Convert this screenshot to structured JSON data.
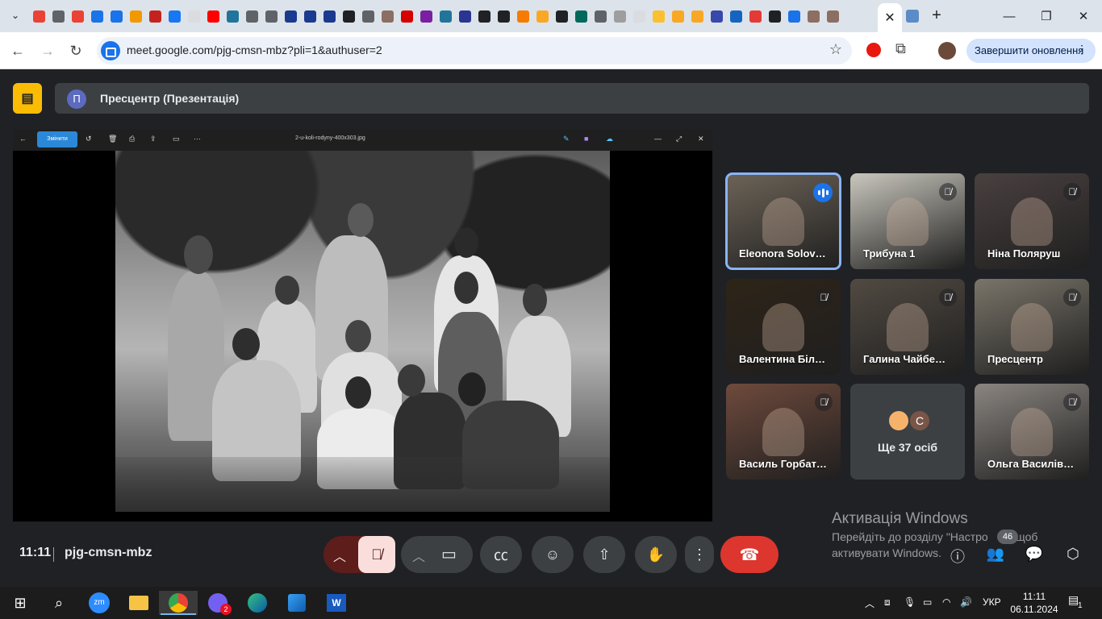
{
  "browser": {
    "url": "meet.google.com/pjg-cmsn-mbz?pli=1&authuser=2",
    "update_button": "Завершити оновлення",
    "active_tab_close": "✕",
    "new_tab": "+",
    "window": {
      "minimize": "—",
      "maximize": "❐",
      "close": "✕"
    },
    "pinned_favicon_colors": [
      "#ea4335",
      "#5f6368",
      "#ea4335",
      "#1a73e8",
      "#1a73e8",
      "#f29900",
      "#c5221f",
      "#1877f2",
      "#dadce0",
      "#ff0000",
      "#21759b",
      "#5f6368",
      "#5f6368",
      "#1a3a8f",
      "#1a3a8f",
      "#1a3a8f",
      "#202124",
      "#5f6368",
      "#8d6e63",
      "#d50000",
      "#7b1fa2",
      "#21759b",
      "#283593",
      "#202124",
      "#202124",
      "#f57c00",
      "#f9a825",
      "#202124",
      "#00695c",
      "#5f6368",
      "#9e9e9e",
      "#dadce0",
      "#fbc02d",
      "#f9a825",
      "#f9a825",
      "#3949ab",
      "#1565c0",
      "#e53935",
      "#202124",
      "#1a73e8",
      "#8d6e63",
      "#8d6e63"
    ]
  },
  "presentation": {
    "avatar_letter": "П",
    "title": "Пресцентр (Презентація)",
    "viewer": {
      "edit_label": "Змінити",
      "file_name": "2-u-koli-rodyny-400x303.jpg"
    }
  },
  "participants": [
    {
      "name": "Eleonora Solov…",
      "muted": false,
      "speaking": true,
      "bg": "#6d6458"
    },
    {
      "name": "Трибуна 1",
      "muted": true,
      "speaking": false,
      "bg": "#c9c7bd"
    },
    {
      "name": "Ніна Поляруш",
      "muted": true,
      "speaking": false,
      "bg": "#4a4040"
    },
    {
      "name": "Валентина Біл…",
      "muted": true,
      "speaking": false,
      "bg": "#2e2418"
    },
    {
      "name": "Галина Чайбе…",
      "muted": true,
      "speaking": false,
      "bg": "#514a42"
    },
    {
      "name": "Пресцентр",
      "muted": true,
      "speaking": false,
      "bg": "#7a756a"
    },
    {
      "name": "Василь Горбат…",
      "muted": true,
      "speaking": false,
      "bg": "#6e4a3c"
    },
    {
      "name": "Ще 37 осіб",
      "more": true
    },
    {
      "name": "Ольга Василів…",
      "muted": true,
      "speaking": false,
      "bg": "#8a8580"
    }
  ],
  "more_tile": {
    "avatar_letter": "С"
  },
  "watermark": {
    "title": "Активація Windows",
    "line1": "Перейдіть до розділу \"Настро",
    "line1_tail": "\", щоб",
    "line2": "активувати Windows."
  },
  "controls": {
    "time": "11:11",
    "meeting_code": "pjg-cmsn-mbz",
    "people_count": "46"
  },
  "taskbar": {
    "language": "УКР",
    "time": "11:11",
    "date": "06.11.2024",
    "viber_badge": "2",
    "notifications": "1"
  }
}
